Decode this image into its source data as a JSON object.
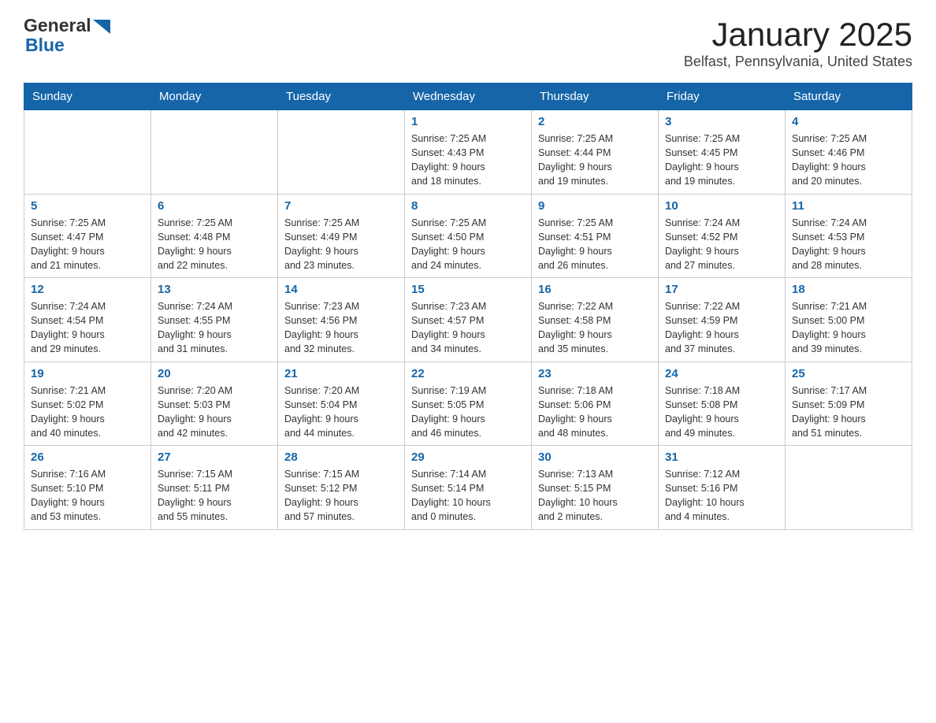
{
  "header": {
    "month_title": "January 2025",
    "location": "Belfast, Pennsylvania, United States"
  },
  "logo": {
    "line1": "General",
    "line2": "Blue"
  },
  "days_of_week": [
    "Sunday",
    "Monday",
    "Tuesday",
    "Wednesday",
    "Thursday",
    "Friday",
    "Saturday"
  ],
  "weeks": [
    [
      {
        "day": "",
        "info": ""
      },
      {
        "day": "",
        "info": ""
      },
      {
        "day": "",
        "info": ""
      },
      {
        "day": "1",
        "info": "Sunrise: 7:25 AM\nSunset: 4:43 PM\nDaylight: 9 hours\nand 18 minutes."
      },
      {
        "day": "2",
        "info": "Sunrise: 7:25 AM\nSunset: 4:44 PM\nDaylight: 9 hours\nand 19 minutes."
      },
      {
        "day": "3",
        "info": "Sunrise: 7:25 AM\nSunset: 4:45 PM\nDaylight: 9 hours\nand 19 minutes."
      },
      {
        "day": "4",
        "info": "Sunrise: 7:25 AM\nSunset: 4:46 PM\nDaylight: 9 hours\nand 20 minutes."
      }
    ],
    [
      {
        "day": "5",
        "info": "Sunrise: 7:25 AM\nSunset: 4:47 PM\nDaylight: 9 hours\nand 21 minutes."
      },
      {
        "day": "6",
        "info": "Sunrise: 7:25 AM\nSunset: 4:48 PM\nDaylight: 9 hours\nand 22 minutes."
      },
      {
        "day": "7",
        "info": "Sunrise: 7:25 AM\nSunset: 4:49 PM\nDaylight: 9 hours\nand 23 minutes."
      },
      {
        "day": "8",
        "info": "Sunrise: 7:25 AM\nSunset: 4:50 PM\nDaylight: 9 hours\nand 24 minutes."
      },
      {
        "day": "9",
        "info": "Sunrise: 7:25 AM\nSunset: 4:51 PM\nDaylight: 9 hours\nand 26 minutes."
      },
      {
        "day": "10",
        "info": "Sunrise: 7:24 AM\nSunset: 4:52 PM\nDaylight: 9 hours\nand 27 minutes."
      },
      {
        "day": "11",
        "info": "Sunrise: 7:24 AM\nSunset: 4:53 PM\nDaylight: 9 hours\nand 28 minutes."
      }
    ],
    [
      {
        "day": "12",
        "info": "Sunrise: 7:24 AM\nSunset: 4:54 PM\nDaylight: 9 hours\nand 29 minutes."
      },
      {
        "day": "13",
        "info": "Sunrise: 7:24 AM\nSunset: 4:55 PM\nDaylight: 9 hours\nand 31 minutes."
      },
      {
        "day": "14",
        "info": "Sunrise: 7:23 AM\nSunset: 4:56 PM\nDaylight: 9 hours\nand 32 minutes."
      },
      {
        "day": "15",
        "info": "Sunrise: 7:23 AM\nSunset: 4:57 PM\nDaylight: 9 hours\nand 34 minutes."
      },
      {
        "day": "16",
        "info": "Sunrise: 7:22 AM\nSunset: 4:58 PM\nDaylight: 9 hours\nand 35 minutes."
      },
      {
        "day": "17",
        "info": "Sunrise: 7:22 AM\nSunset: 4:59 PM\nDaylight: 9 hours\nand 37 minutes."
      },
      {
        "day": "18",
        "info": "Sunrise: 7:21 AM\nSunset: 5:00 PM\nDaylight: 9 hours\nand 39 minutes."
      }
    ],
    [
      {
        "day": "19",
        "info": "Sunrise: 7:21 AM\nSunset: 5:02 PM\nDaylight: 9 hours\nand 40 minutes."
      },
      {
        "day": "20",
        "info": "Sunrise: 7:20 AM\nSunset: 5:03 PM\nDaylight: 9 hours\nand 42 minutes."
      },
      {
        "day": "21",
        "info": "Sunrise: 7:20 AM\nSunset: 5:04 PM\nDaylight: 9 hours\nand 44 minutes."
      },
      {
        "day": "22",
        "info": "Sunrise: 7:19 AM\nSunset: 5:05 PM\nDaylight: 9 hours\nand 46 minutes."
      },
      {
        "day": "23",
        "info": "Sunrise: 7:18 AM\nSunset: 5:06 PM\nDaylight: 9 hours\nand 48 minutes."
      },
      {
        "day": "24",
        "info": "Sunrise: 7:18 AM\nSunset: 5:08 PM\nDaylight: 9 hours\nand 49 minutes."
      },
      {
        "day": "25",
        "info": "Sunrise: 7:17 AM\nSunset: 5:09 PM\nDaylight: 9 hours\nand 51 minutes."
      }
    ],
    [
      {
        "day": "26",
        "info": "Sunrise: 7:16 AM\nSunset: 5:10 PM\nDaylight: 9 hours\nand 53 minutes."
      },
      {
        "day": "27",
        "info": "Sunrise: 7:15 AM\nSunset: 5:11 PM\nDaylight: 9 hours\nand 55 minutes."
      },
      {
        "day": "28",
        "info": "Sunrise: 7:15 AM\nSunset: 5:12 PM\nDaylight: 9 hours\nand 57 minutes."
      },
      {
        "day": "29",
        "info": "Sunrise: 7:14 AM\nSunset: 5:14 PM\nDaylight: 10 hours\nand 0 minutes."
      },
      {
        "day": "30",
        "info": "Sunrise: 7:13 AM\nSunset: 5:15 PM\nDaylight: 10 hours\nand 2 minutes."
      },
      {
        "day": "31",
        "info": "Sunrise: 7:12 AM\nSunset: 5:16 PM\nDaylight: 10 hours\nand 4 minutes."
      },
      {
        "day": "",
        "info": ""
      }
    ]
  ]
}
